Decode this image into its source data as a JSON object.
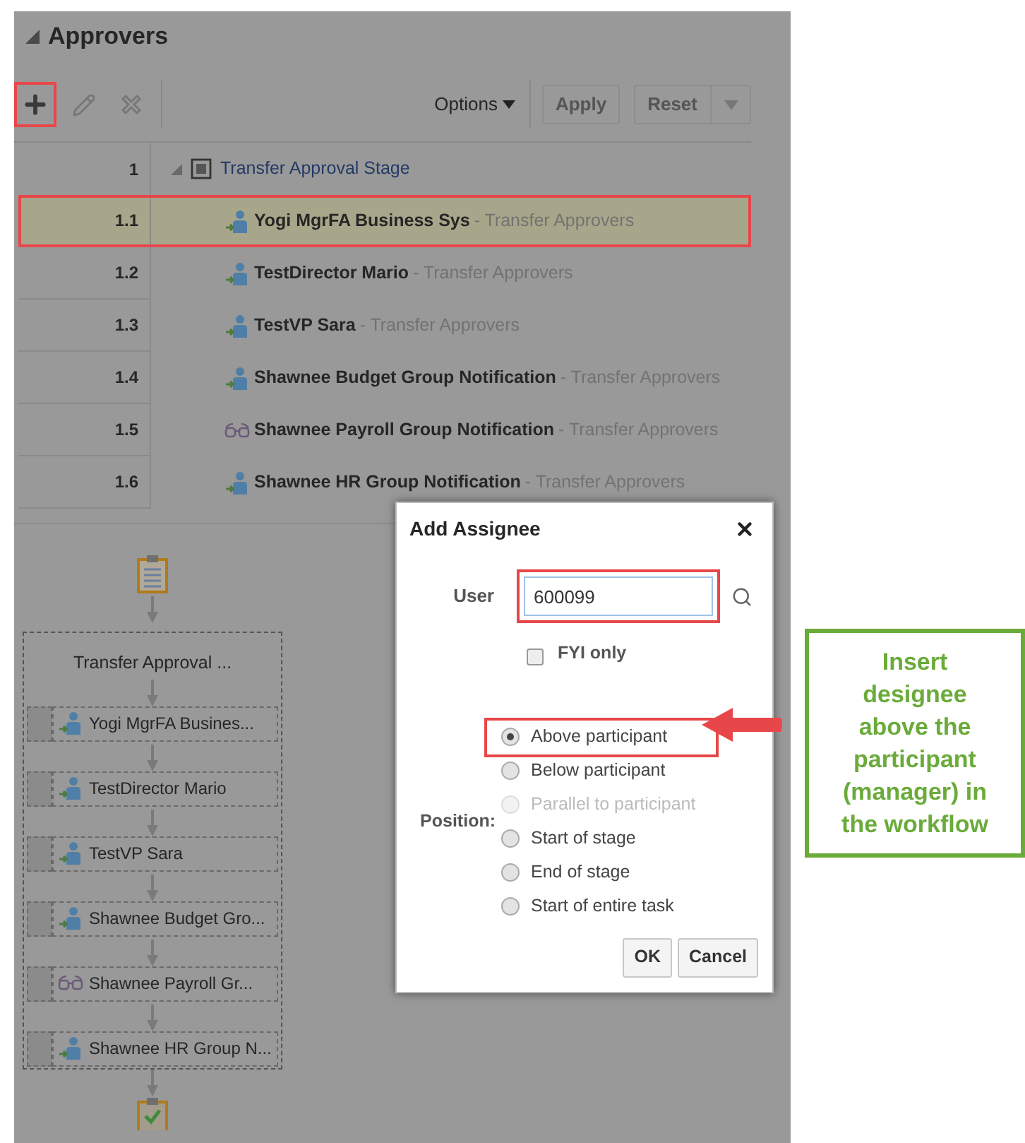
{
  "section": {
    "title": "Approvers",
    "expanded": true
  },
  "toolbar": {
    "tools": [
      {
        "kind": "add",
        "highlighted": true
      },
      {
        "kind": "edit",
        "highlighted": false
      },
      {
        "kind": "delete",
        "highlighted": false
      }
    ],
    "options_menu": "Options",
    "apply_button": "Apply",
    "reset_button": "Reset"
  },
  "tree": {
    "rows": [
      {
        "number": "1",
        "label": "Transfer Approval Stage",
        "expanded": true,
        "children": [
          {
            "number": "1.1",
            "kind": "user",
            "name": "Yogi MgrFA Business Sys",
            "role": "- Transfer Approvers",
            "selected": true,
            "highlighted": true
          },
          {
            "number": "1.2",
            "kind": "user",
            "name": "TestDirector Mario",
            "role": "- Transfer Approvers",
            "selected": false,
            "highlighted": false
          },
          {
            "number": "1.3",
            "kind": "user",
            "name": "TestVP Sara",
            "role": "- Transfer Approvers",
            "selected": false,
            "highlighted": false
          },
          {
            "number": "1.4",
            "kind": "user",
            "name": "Shawnee Budget Group Notification",
            "role": "- Transfer Approvers",
            "selected": false,
            "highlighted": false
          },
          {
            "number": "1.5",
            "kind": "fyi",
            "name": "Shawnee Payroll Group Notification",
            "role": "- Transfer Approvers",
            "selected": false,
            "highlighted": false
          },
          {
            "number": "1.6",
            "kind": "user",
            "name": "Shawnee HR Group Notification",
            "role": "- Transfer Approvers",
            "selected": false,
            "highlighted": false
          }
        ]
      }
    ]
  },
  "diagram": {
    "stage": "Transfer Approval ...",
    "nodes": [
      {
        "kind": "user",
        "label": "Yogi MgrFA Busines..."
      },
      {
        "kind": "user",
        "label": "TestDirector Mario"
      },
      {
        "kind": "user",
        "label": "TestVP Sara"
      },
      {
        "kind": "user",
        "label": "Shawnee Budget Gro..."
      },
      {
        "kind": "fyi",
        "label": "Shawnee Payroll Gr..."
      },
      {
        "kind": "user",
        "label": "Shawnee HR Group N..."
      }
    ]
  },
  "dialog": {
    "title": "Add Assignee",
    "user_label": "User",
    "user_value": "600099",
    "user_highlighted": true,
    "fyi": {
      "label": "FYI only",
      "checked": false
    },
    "position_label": "Position:",
    "options": [
      {
        "label": "Above participant",
        "selected": true,
        "disabled": false,
        "highlighted": true
      },
      {
        "label": "Below participant",
        "selected": false,
        "disabled": false,
        "highlighted": false
      },
      {
        "label": "Parallel to participant",
        "selected": false,
        "disabled": true,
        "highlighted": false
      },
      {
        "label": "Start of stage",
        "selected": false,
        "disabled": false,
        "highlighted": false
      },
      {
        "label": "End of stage",
        "selected": false,
        "disabled": false,
        "highlighted": false
      },
      {
        "label": "Start of entire task",
        "selected": false,
        "disabled": false,
        "highlighted": false
      }
    ],
    "buttons": [
      "OK",
      "Cancel"
    ]
  },
  "callout": {
    "text": "Insert designee above the participant (manager) in the workflow"
  }
}
